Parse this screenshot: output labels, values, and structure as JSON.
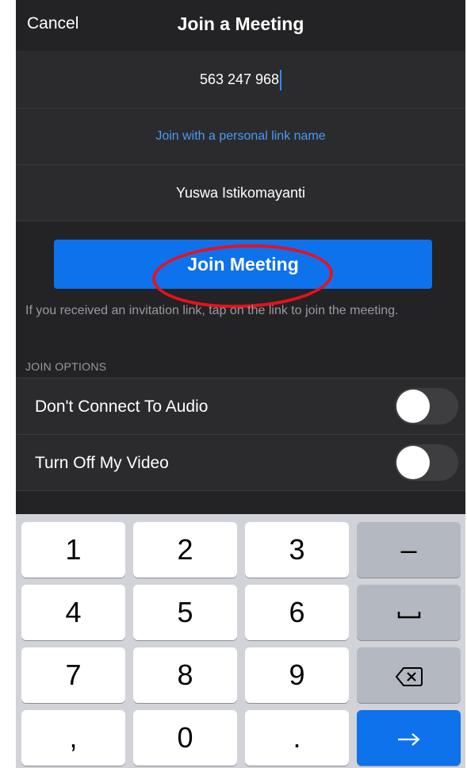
{
  "header": {
    "cancel_label": "Cancel",
    "title": "Join a Meeting"
  },
  "meeting_id": {
    "value": "563 247 968"
  },
  "personal_link": {
    "label": "Join with a personal link name"
  },
  "name_field": {
    "value": "Yuswa Istikomayanti"
  },
  "join_button": {
    "label": "Join Meeting"
  },
  "hint_text": "If you received an invitation link, tap on the link to join the meeting.",
  "join_options": {
    "header": "JOIN OPTIONS",
    "items": [
      {
        "label": "Don't Connect To Audio",
        "enabled": false
      },
      {
        "label": "Turn Off My Video",
        "enabled": false
      }
    ]
  },
  "keyboard": {
    "keys": [
      "1",
      "2",
      "3",
      "–",
      "4",
      "5",
      "6",
      "7",
      "8",
      "9",
      ",",
      "0",
      "."
    ],
    "icons": {
      "space": "space-bar-icon",
      "backspace": "backspace-icon",
      "enter": "arrow-right-icon"
    }
  },
  "colors": {
    "accent": "#0e72ed",
    "link": "#4a9af7",
    "annotation": "#e8111c",
    "background": "#232325"
  }
}
